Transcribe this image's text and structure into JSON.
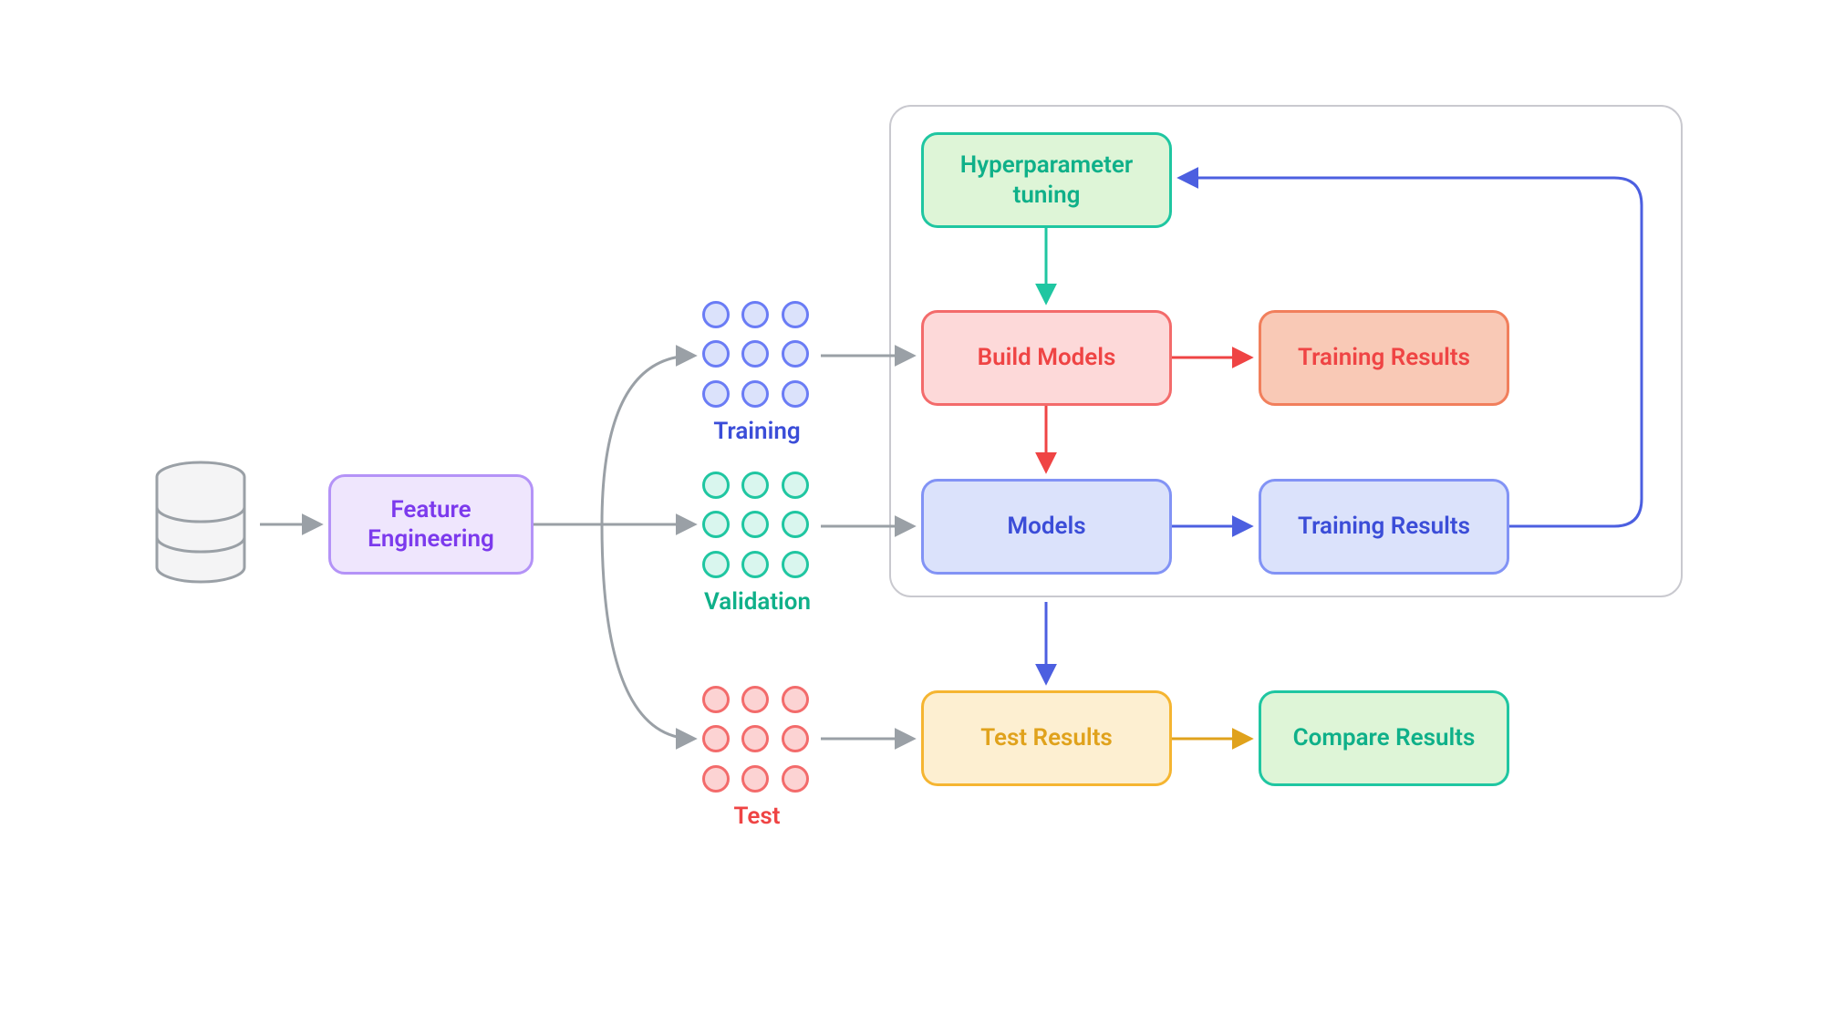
{
  "colors": {
    "purple_border": "#9a6ef3",
    "purple_fill": "#efe6fd",
    "purple_text": "#7c3aed",
    "blue_border": "#6a7cf5",
    "blue_fill": "#dbe2fb",
    "blue_text": "#3b4dd8",
    "teal_border": "#1fc6a1",
    "teal_fill": "#d9f6ee",
    "teal_text": "#0fb089",
    "red_border": "#f36b6b",
    "red_fill_light": "#fdd9d9",
    "red_text": "#ef4444",
    "orange_fill": "#f9c9b6",
    "orange_border": "#f09673",
    "yellow_border": "#f5b531",
    "yellow_fill": "#fdefd1",
    "yellow_text": "#e0a21c",
    "green_fill": "#def5d7",
    "gray_arrow": "#9aa0a6",
    "gray_stroke": "#b0b0b0"
  },
  "nodes": {
    "feature_engineering": "Feature Engineering",
    "hyperparameter_tuning": "Hyperparameter tuning",
    "build_models": "Build Models",
    "training_results_1": "Training Results",
    "models": "Models",
    "training_results_2": "Training Results",
    "test_results": "Test Results",
    "compare_results": "Compare Results"
  },
  "labels": {
    "training": "Training",
    "validation": "Validation",
    "test": "Test"
  },
  "icons": {
    "database": "database-icon"
  }
}
